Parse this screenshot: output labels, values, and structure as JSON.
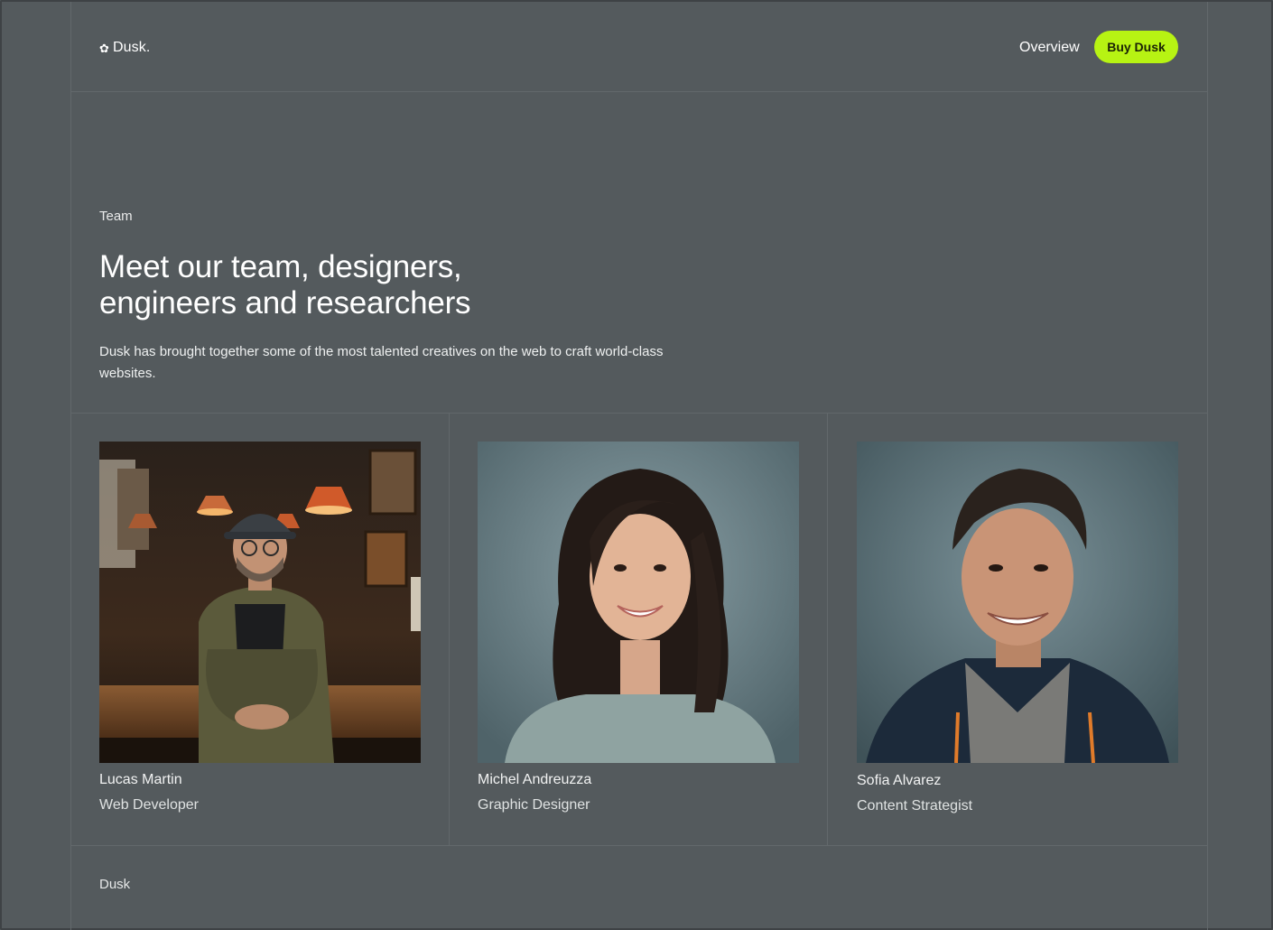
{
  "header": {
    "brand": "Dusk.",
    "brand_icon": "flower-icon",
    "nav_overview": "Overview",
    "buy_button": "Buy Dusk",
    "accent_color": "#b7f313"
  },
  "hero": {
    "eyebrow": "Team",
    "headline_line1": "Meet our team, designers,",
    "headline_line2": "engineers and researchers",
    "lead": "Dusk has brought together some of the most talented creatives on the web to craft world-class websites."
  },
  "team": [
    {
      "name": "Lucas Martin",
      "role": "Web Developer"
    },
    {
      "name": "Michel Andreuzza",
      "role": "Graphic Designer"
    },
    {
      "name": "Sofia Alvarez",
      "role": "Content Strategist"
    }
  ],
  "footer": {
    "brand": "Dusk"
  },
  "colors": {
    "background": "#545a5d",
    "divider": "#62686b"
  }
}
